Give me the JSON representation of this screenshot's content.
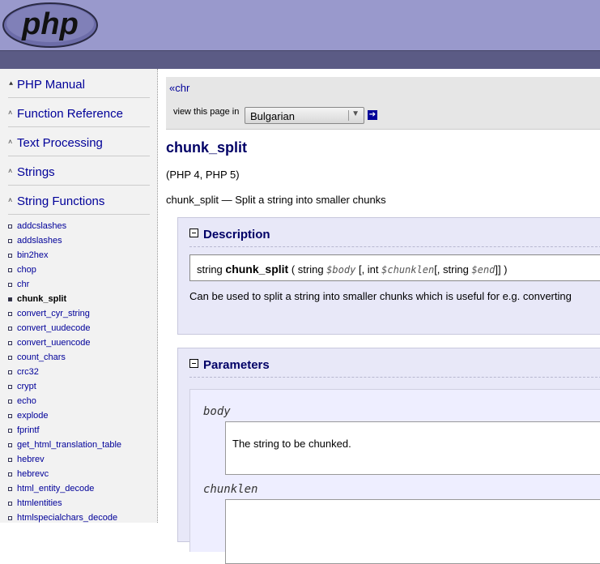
{
  "header": {
    "logo_text": "php",
    "colors": {
      "bg": "#9999cc",
      "bar": "#5b5b85"
    }
  },
  "sidebar": {
    "sections": [
      {
        "label": "PHP Manual",
        "icon": "double-up-arrow-icon"
      },
      {
        "label": "Function Reference",
        "icon": "up-arrow-icon"
      },
      {
        "label": "Text Processing",
        "icon": "up-arrow-icon"
      },
      {
        "label": "Strings",
        "icon": "up-arrow-icon"
      },
      {
        "label": "String Functions",
        "icon": "up-arrow-icon"
      }
    ],
    "items": [
      "addcslashes",
      "addslashes",
      "bin2hex",
      "chop",
      "chr",
      "chunk_split",
      "convert_cyr_string",
      "convert_uudecode",
      "convert_uuencode",
      "count_chars",
      "crc32",
      "crypt",
      "echo",
      "explode",
      "fprintf",
      "get_html_translation_table",
      "hebrev",
      "hebrevc",
      "html_entity_decode",
      "htmlentities",
      "htmlspecialchars_decode"
    ],
    "current_item": "chunk_split"
  },
  "nav": {
    "prev_arrow": "«",
    "prev_label": "chr",
    "view_label": "view this page in",
    "language": "Bulgarian",
    "go_icon": "right-arrow-icon"
  },
  "content": {
    "title": "chunk_split",
    "versions": "(PHP 4, PHP 5)",
    "purpose": "chunk_split — Split a string into smaller chunks",
    "description": {
      "heading": "Description",
      "syn_type": "string",
      "syn_name": "chunk_split",
      "syn_open": "( string",
      "syn_p1": "$body",
      "syn_mid1": "[, int",
      "syn_p2": "$chunklen",
      "syn_mid2": "[, string",
      "syn_p3": "$end",
      "syn_close": "]] )",
      "text": "Can be used to split a string into smaller chunks which is useful for e.g. converting"
    },
    "parameters": {
      "heading": "Parameters",
      "items": [
        {
          "name": "body",
          "desc": "The string to be chunked."
        },
        {
          "name": "chunklen",
          "desc": ""
        }
      ]
    }
  }
}
